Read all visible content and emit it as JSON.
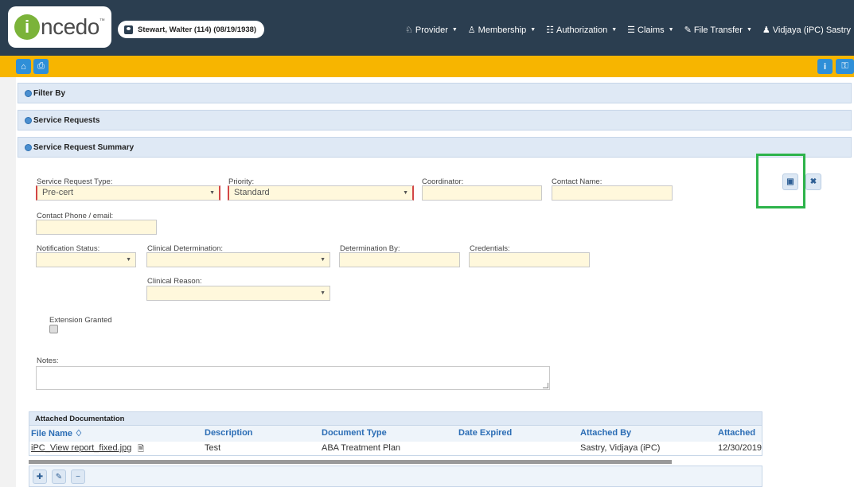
{
  "header": {
    "logo_letter": "i",
    "logo_text": "ncedo",
    "patient": "Stewart, Walter (114) (08/19/1938)",
    "nav": [
      {
        "label": "Provider",
        "icon": "provider-icon"
      },
      {
        "label": "Membership",
        "icon": "membership-icon"
      },
      {
        "label": "Authorization",
        "icon": "authorization-icon"
      },
      {
        "label": "Claims",
        "icon": "claims-icon"
      },
      {
        "label": "File Transfer",
        "icon": "file-transfer-icon"
      },
      {
        "label": "Vidjaya (iPC) Sastry",
        "icon": "user-icon"
      }
    ]
  },
  "sections": {
    "filter_by": "Filter By",
    "service_requests": "Service Requests",
    "summary": "Service Request Summary"
  },
  "form": {
    "service_request_type": {
      "label": "Service Request Type:",
      "value": "Pre-cert"
    },
    "priority": {
      "label": "Priority:",
      "value": "Standard"
    },
    "coordinator": {
      "label": "Coordinator:",
      "value": ""
    },
    "contact_name": {
      "label": "Contact Name:",
      "value": ""
    },
    "contact_phone": {
      "label": "Contact Phone / email:",
      "value": ""
    },
    "notification_status": {
      "label": "Notification Status:",
      "value": ""
    },
    "clinical_determination": {
      "label": "Clinical Determination:",
      "value": ""
    },
    "determination_by": {
      "label": "Determination By:",
      "value": ""
    },
    "credentials": {
      "label": "Credentials:",
      "value": ""
    },
    "clinical_reason": {
      "label": "Clinical Reason:",
      "value": ""
    },
    "extension_granted": {
      "label": "Extension Granted",
      "checked": false
    },
    "notes": {
      "label": "Notes:",
      "value": ""
    }
  },
  "attachments": {
    "title": "Attached Documentation",
    "columns": [
      "File Name ♢",
      "Description",
      "Document Type",
      "Date Expired",
      "Attached By",
      "Attached"
    ],
    "rows": [
      {
        "file_name": "iPC_View report_fixed.jpg",
        "description": "Test",
        "document_type": "ABA Treatment Plan",
        "date_expired": "",
        "attached_by": "Sastry, Vidjaya (iPC)",
        "attached": "12/30/2019"
      }
    ]
  },
  "colors": {
    "topbar": "#2b3e50",
    "toolbar": "#f7b500",
    "accent": "#2f8fd8",
    "highlight": "#2db34a"
  }
}
